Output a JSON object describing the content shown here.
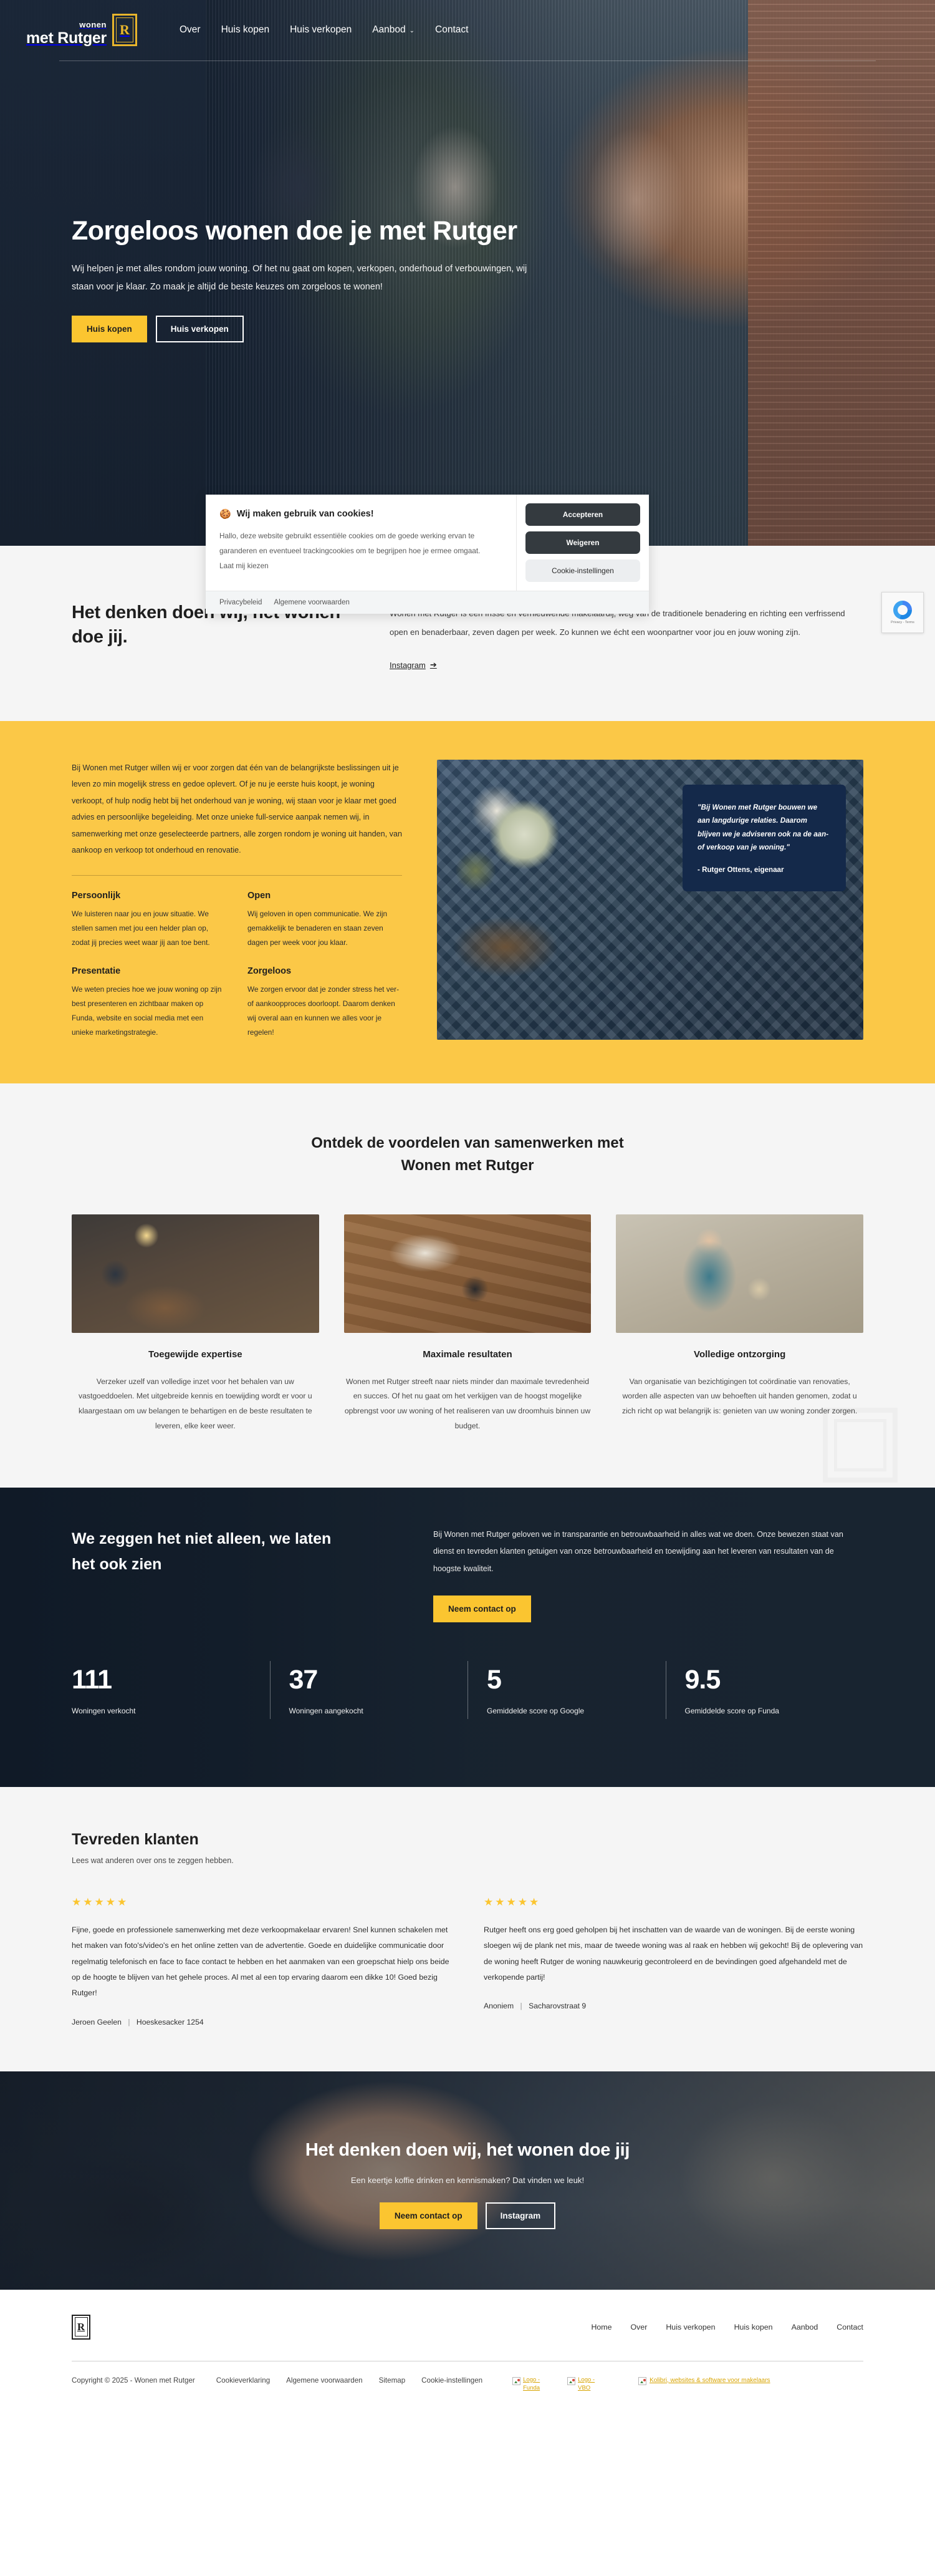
{
  "brand": {
    "wonen": "wonen",
    "name": "met Rutger",
    "mark": "R"
  },
  "nav": {
    "items": [
      {
        "label": "Over",
        "caret": false
      },
      {
        "label": "Huis kopen",
        "caret": false
      },
      {
        "label": "Huis verkopen",
        "caret": false
      },
      {
        "label": "Aanbod",
        "caret": true,
        "caret_glyph": "⌄"
      },
      {
        "label": "Contact",
        "caret": false
      }
    ]
  },
  "hero": {
    "title": "Zorgeloos wonen doe je met Rutger",
    "subtitle": "Wij helpen je met alles rondom jouw woning. Of het nu gaat om kopen, verkopen, onderhoud of verbouwingen, wij staan voor je klaar. Zo maak je altijd de beste keuzes om zorgeloos te wonen!",
    "btn_primary": "Huis kopen",
    "btn_secondary": "Huis verkopen"
  },
  "cookie": {
    "icon": "🍪",
    "title": "Wij maken gebruik van cookies!",
    "body": "Hallo, deze website gebruikt essentiële cookies om de goede werking ervan te garanderen en eventueel trackingcookies om te begrijpen hoe je ermee omgaat.",
    "choose_link": "Laat mij kiezen",
    "accept": "Accepteren",
    "decline": "Weigeren",
    "settings": "Cookie-instellingen",
    "privacy": "Privacybeleid",
    "terms": "Algemene voorwaarden"
  },
  "intro": {
    "title_line1": "Het denken doen wij, het wonen",
    "title_line2": "doe jij.",
    "quote_mark": "”",
    "paragraph": "Wonen met Rutger is een frisse en vernieuwende makelaardij, weg van de traditionele benadering en richting een verfrissend open en benaderbaar, zeven dagen per week. Zo kunnen we écht een woonpartner voor jou en jouw woning zijn.",
    "link": "Instagram",
    "link_arrow": "➔",
    "recaptcha_label": "Privacy - Terms"
  },
  "yellow": {
    "paragraph": "Bij Wonen met Rutger willen wij er voor zorgen dat één van de belangrijkste beslissingen uit je leven zo min mogelijk stress en gedoe oplevert. Of je nu je eerste huis koopt, je woning verkoopt, of hulp nodig hebt bij het onderhoud van je woning, wij staan voor je klaar met goed advies en persoonlijke begeleiding. Met onze unieke full-service aanpak nemen wij, in samenwerking met onze geselecteerde partners, alle zorgen rondom je woning uit handen, van aankoop en verkoop tot onderhoud en renovatie.",
    "usps": [
      {
        "title": "Persoonlijk",
        "body": "We luisteren naar jou en jouw situatie. We stellen samen met jou een helder plan op, zodat jij precies weet waar jij aan toe bent."
      },
      {
        "title": "Open",
        "body": "Wij geloven in open communicatie. We zijn gemakkelijk te benaderen en staan zeven dagen per week voor jou klaar."
      },
      {
        "title": "Presentatie",
        "body": "We weten precies hoe we jouw woning op zijn best presenteren en zichtbaar maken op Funda, website en social media met een unieke marketingstrategie."
      },
      {
        "title": "Zorgeloos",
        "body": "We zorgen ervoor dat je zonder stress het ver- of aankoopproces doorloopt. Daarom denken wij overal aan en kunnen we alles voor je regelen!"
      }
    ],
    "quote": "\"Bij Wonen met Rutger bouwen we aan langdurige relaties. Daarom blijven we je adviseren ook na de aan- of verkoop van je woning.\"",
    "quote_author": "- Rutger Ottens, eigenaar"
  },
  "benefits": {
    "heading_line1": "Ontdek de voordelen van samenwerken met",
    "heading_line2": "Wonen met Rutger",
    "cards": [
      {
        "title": "Toegewijde expertise",
        "body": "Verzeker uzelf van volledige inzet voor het behalen van uw vastgoeddoelen. Met uitgebreide kennis en toewijding wordt er voor u klaargestaan om uw belangen te behartigen en de beste resultaten te leveren, elke keer weer."
      },
      {
        "title": "Maximale resultaten",
        "body": "Wonen met Rutger streeft naar niets minder dan maximale tevredenheid en succes. Of het nu gaat om het verkijgen van de hoogst mogelijke opbrengst voor uw woning of het realiseren van uw droomhuis binnen uw budget."
      },
      {
        "title": "Volledige ontzorging",
        "body": "Van organisatie van bezichtigingen tot coördinatie van renovaties, worden alle aspecten van uw behoeften uit handen genomen, zodat u zich richt op wat belangrijk is: genieten van uw woning zonder zorgen."
      }
    ]
  },
  "stats": {
    "heading_line1": "We zeggen het niet alleen, we laten",
    "heading_line2": "het ook zien",
    "paragraph": "Bij Wonen met Rutger geloven we in transparantie en betrouwbaarheid in alles wat we doen. Onze bewezen staat van dienst en tevreden klanten getuigen van onze betrouwbaarheid en toewijding aan het leveren van resultaten van de hoogste kwaliteit.",
    "cta": "Neem contact op",
    "items": [
      {
        "value": "111",
        "label": "Woningen verkocht"
      },
      {
        "value": "37",
        "label": "Woningen aangekocht"
      },
      {
        "value": "5",
        "label": "Gemiddelde score op Google"
      },
      {
        "value": "9.5",
        "label": "Gemiddelde score op Funda"
      }
    ]
  },
  "reviews": {
    "heading": "Tevreden klanten",
    "subtitle": "Lees wat anderen over ons te zeggen hebben.",
    "stars": "★★★★★",
    "items": [
      {
        "text": "Fijne, goede en professionele samenwerking met deze verkoopmakelaar ervaren! Snel kunnen schakelen met het maken van foto's/video's en het online zetten van de advertentie. Goede en duidelijke communicatie door regelmatig telefonisch en face to face contact te hebben en het aanmaken van een groepschat hielp ons beide op de hoogte te blijven van het gehele proces. Al met al een top ervaring daarom een dikke 10! Goed bezig Rutger!",
        "author": "Jeroen Geelen",
        "location": "Hoeskesacker 1254"
      },
      {
        "text": "Rutger heeft ons erg goed geholpen bij het inschatten van de waarde van de woningen. Bij de eerste woning sloegen wij de plank net mis, maar de tweede woning was al raak en hebben wij gekocht! Bij de oplevering van de woning heeft Rutger de woning nauwkeurig gecontroleerd en de bevindingen goed afgehandeld met de verkopende partij!",
        "author": "Anoniem",
        "location": "Sacharovstraat 9"
      }
    ]
  },
  "cta": {
    "heading": "Het denken doen wij, het wonen doe jij",
    "paragraph": "Een keertje koffie drinken en kennismaken? Dat vinden we leuk!",
    "btn_primary": "Neem contact op",
    "btn_secondary": "Instagram"
  },
  "footer": {
    "logo_mark": "R",
    "nav": [
      "Home",
      "Over",
      "Huis verkopen",
      "Huis kopen",
      "Aanbod",
      "Contact"
    ],
    "copyright": "Copyright © 2025 - Wonen met Rutger",
    "links": [
      "Cookieverklaring",
      "Algemene voorwaarden",
      "Sitemap",
      "Cookie-instellingen"
    ],
    "broken_images": [
      "Logo - Funda",
      "Logo - VBO"
    ],
    "partner_link": "Kolibri, websites & software voor makelaars"
  },
  "colors": {
    "brand_yellow": "#fbc530",
    "yellow_section": "#fbc847",
    "dark_navy": "#14294a",
    "page_grey": "#f5f5f5"
  }
}
